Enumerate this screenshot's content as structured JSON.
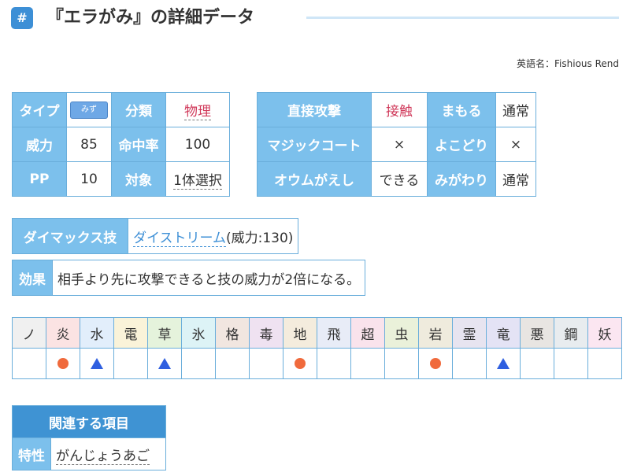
{
  "header": {
    "hash": "#",
    "title": "『エラがみ』の詳細データ"
  },
  "english_name": "英語名：Fishious Rend",
  "stats": {
    "type_label": "タイプ",
    "type_badge": "みず",
    "category_label": "分類",
    "category_value": "物理",
    "power_label": "威力",
    "power_value": "85",
    "accuracy_label": "命中率",
    "accuracy_value": "100",
    "pp_label": "PP",
    "pp_value": "10",
    "target_label": "対象",
    "target_value": "1体選択"
  },
  "props": {
    "contact_label": "直接攻撃",
    "contact_value": "接触",
    "protect_label": "まもる",
    "protect_value": "通常",
    "magic_coat_label": "マジックコート",
    "magic_coat_value": "×",
    "snatch_label": "よこどり",
    "snatch_value": "×",
    "mirror_label": "オウムがえし",
    "mirror_value": "できる",
    "substitute_label": "みがわり",
    "substitute_value": "通常"
  },
  "dynamax": {
    "label": "ダイマックス技",
    "move": "ダイストリーム",
    "power": "(威力:130)"
  },
  "effect": {
    "label": "効果",
    "text": "相手より先に攻撃できると技の威力が2倍になる。"
  },
  "types_table": {
    "types": [
      {
        "name": "ノ",
        "bg": "#f0f0f0",
        "mark": ""
      },
      {
        "name": "炎",
        "bg": "#fbe3e3",
        "mark": "circle"
      },
      {
        "name": "水",
        "bg": "#e2eefb",
        "mark": "triangle"
      },
      {
        "name": "電",
        "bg": "#faf3d9",
        "mark": ""
      },
      {
        "name": "草",
        "bg": "#e5f3dc",
        "mark": "triangle"
      },
      {
        "name": "氷",
        "bg": "#ddf3f6",
        "mark": ""
      },
      {
        "name": "格",
        "bg": "#f1e6e0",
        "mark": ""
      },
      {
        "name": "毒",
        "bg": "#efe2f1",
        "mark": ""
      },
      {
        "name": "地",
        "bg": "#f4ecdd",
        "mark": "circle"
      },
      {
        "name": "飛",
        "bg": "#e8ecf7",
        "mark": ""
      },
      {
        "name": "超",
        "bg": "#f9e3ec",
        "mark": ""
      },
      {
        "name": "虫",
        "bg": "#eaf1da",
        "mark": ""
      },
      {
        "name": "岩",
        "bg": "#efebdd",
        "mark": "circle"
      },
      {
        "name": "霊",
        "bg": "#e7e4f0",
        "mark": ""
      },
      {
        "name": "竜",
        "bg": "#e4e3f5",
        "mark": "triangle"
      },
      {
        "name": "悪",
        "bg": "#e8e5e2",
        "mark": ""
      },
      {
        "name": "鋼",
        "bg": "#e8ecef",
        "mark": ""
      },
      {
        "name": "妖",
        "bg": "#fbe6f1",
        "mark": ""
      }
    ],
    "colors": {
      "circle": "#f06a3c",
      "triangle": "#2f5fe0"
    }
  },
  "related": {
    "title": "関連する項目",
    "ability_label": "特性",
    "ability_value": "がんじょうあご"
  }
}
